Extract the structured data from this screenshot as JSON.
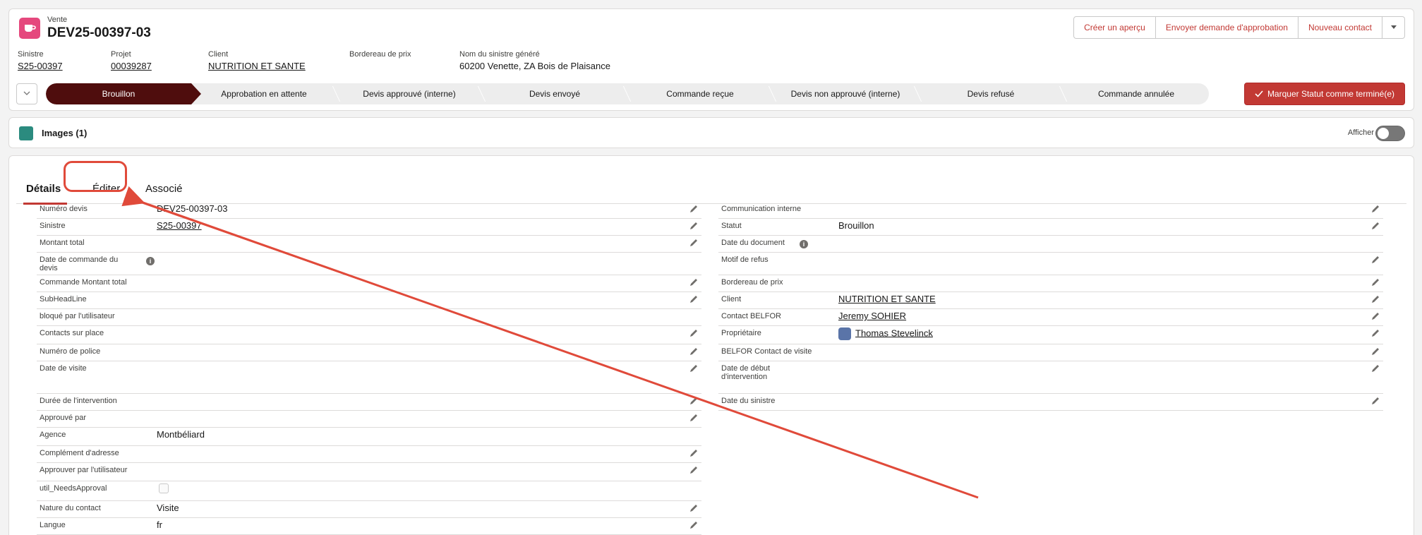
{
  "header": {
    "record_type": "Vente",
    "record_title": "DEV25-00397-03",
    "icon": "cup-icon",
    "buttons": {
      "apercu": "Créer un aperçu",
      "approbation": "Envoyer demande d'approbation",
      "contact": "Nouveau contact"
    },
    "highlights": [
      {
        "label": "Sinistre",
        "value": "S25-00397"
      },
      {
        "label": "Projet",
        "value": "00039287"
      },
      {
        "label": "Client",
        "value": "NUTRITION ET SANTE"
      },
      {
        "label": "Bordereau de prix",
        "value": ""
      },
      {
        "label": "Nom du sinistre généré",
        "value": "60200 Venette, ZA Bois de Plaisance"
      }
    ],
    "path_steps": [
      "Brouillon",
      "Approbation en attente",
      "Devis approuvé (interne)",
      "Devis envoyé",
      "Commande reçue",
      "Devis non approuvé (interne)",
      "Devis refusé",
      "Commande annulée"
    ],
    "mark_button": "Marquer Statut comme terminé(e)"
  },
  "images": {
    "title": "Images (1)",
    "toggle_label": "Afficher"
  },
  "tabs": [
    "Détails",
    "Éditer",
    "Associé"
  ],
  "left_fields": [
    {
      "label": "Numéro devis",
      "value": "DEV25-00397-03",
      "link": false
    },
    {
      "label": "Sinistre",
      "value": "S25-00397",
      "link": true
    },
    {
      "label": "Montant total",
      "value": "",
      "link": false
    },
    {
      "label": "Date de commande du devis",
      "value": "",
      "link": false
    },
    {
      "label": "Commande Montant total",
      "value": "",
      "link": false
    },
    {
      "label": "SubHeadLine",
      "value": "",
      "link": false
    },
    {
      "label": "bloqué par l'utilisateur",
      "value": "",
      "link": false
    },
    {
      "label": "Contacts sur place",
      "value": "",
      "link": false
    },
    {
      "label": "Numéro de police",
      "value": "",
      "link": false
    },
    {
      "label": "Date de visite",
      "value": "",
      "link": false
    },
    {
      "label": "Durée de l'intervention",
      "value": "",
      "link": false
    },
    {
      "label": "Approuvé par",
      "value": "",
      "link": false
    },
    {
      "label": "Agence",
      "value": "Montbéliard",
      "link": false
    },
    {
      "label": "Complément d'adresse",
      "value": "",
      "link": false
    },
    {
      "label": "Approuver par l'utilisateur",
      "value": "",
      "link": false
    },
    {
      "label": "util_NeedsApproval",
      "value": "",
      "link": false
    },
    {
      "label": "Nature du contact",
      "value": "Visite",
      "link": false
    },
    {
      "label": "Langue",
      "value": "fr",
      "link": false
    }
  ],
  "right_fields": [
    {
      "label": "Communication interne",
      "value": "",
      "link": false
    },
    {
      "label": "Statut",
      "value": "Brouillon",
      "link": false
    },
    {
      "label": "Date du document",
      "value": "",
      "link": false
    },
    {
      "label": "Motif de refus",
      "value": "",
      "link": false
    },
    {
      "label": "Bordereau de prix",
      "value": "",
      "link": false
    },
    {
      "label": "Client",
      "value": "NUTRITION ET SANTE",
      "link": true
    },
    {
      "label": "Contact BELFOR",
      "value": "Jeremy SOHIER",
      "link": true
    },
    {
      "label": "Propriétaire",
      "value": "Thomas Stevelinck",
      "link": true
    },
    {
      "label": "BELFOR Contact de visite",
      "value": "",
      "link": false
    },
    {
      "label": "Date de début d'intervention",
      "value": "",
      "link": false
    },
    {
      "label": "Date du sinistre",
      "value": "",
      "link": false
    }
  ],
  "colors": {
    "accent": "#c23934",
    "path_active": "#4f0d0d",
    "annotation": "#e04a3a"
  }
}
